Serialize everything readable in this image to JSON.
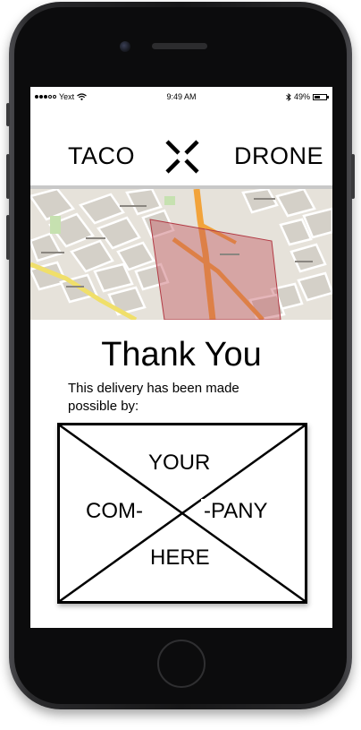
{
  "status_bar": {
    "carrier": "Yext",
    "time": "9:49 AM",
    "battery": "49%",
    "battery_level": 0.49
  },
  "header": {
    "left_word": "TACO",
    "right_word": "DRONE",
    "logo_icon": "x-cross-icon"
  },
  "map": {
    "icon": "map-image",
    "highlight_color": "#c0505a",
    "highway_color": "#f2a33a"
  },
  "main": {
    "title": "Thank You",
    "message": "This delivery has been made possible by:"
  },
  "sponsor": {
    "top": "YOUR",
    "left": "COM-",
    "right": "-PANY",
    "bottom": "HERE"
  }
}
